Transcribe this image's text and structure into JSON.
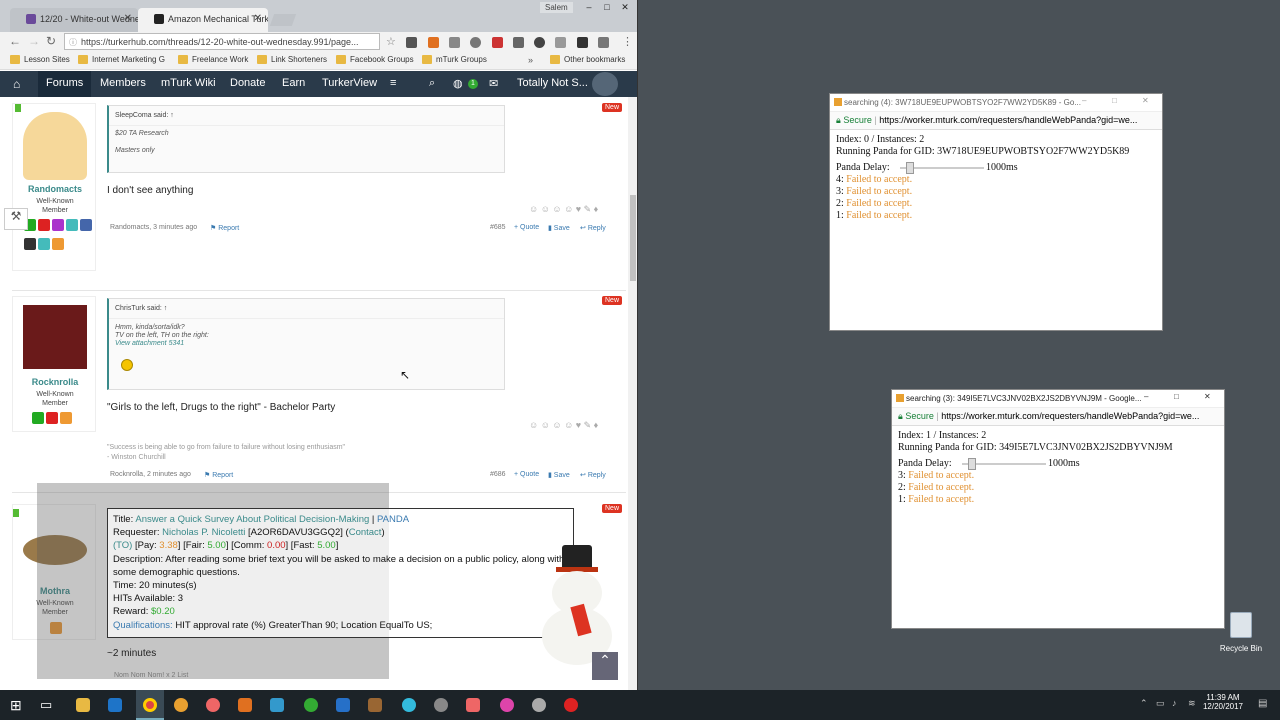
{
  "chrome": {
    "tabs": [
      {
        "label": "12/20 - White-out Wedne"
      },
      {
        "label": "Amazon Mechanical Turk"
      }
    ],
    "user_badge": "Salem",
    "url": "https://turkerhub.com/threads/12-20-white-out-wednesday.991/page...",
    "bookmarks": [
      "Lesson Sites",
      "Internet Marketing G",
      "Freelance Work",
      "Link Shorteners",
      "Facebook Groups",
      "mTurk Groups"
    ],
    "other_bookmarks": "Other bookmarks",
    "overflow": "»"
  },
  "sitenav": {
    "items": [
      "Forums",
      "Members",
      "mTurk Wiki",
      "Donate",
      "Earn",
      "TurkerView"
    ],
    "user": "Totally Not S...",
    "badge": "1"
  },
  "posts": [
    {
      "username": "Randomacts",
      "role": "Well-Known Member",
      "quote_by": "SleepComa said: ↑",
      "quote_lines": [
        "$20 TA Research",
        "Masters only"
      ],
      "message": "I don't see anything",
      "meta": "Randomacts, 3 minutes ago",
      "report": "Report",
      "number": "#685",
      "badge": "New"
    },
    {
      "username": "Rocknrolla",
      "role": "Well-Known Member",
      "quote_by": "ChrisTurk said: ↑",
      "quote_lines": [
        "Hmm, kinda/sorta/idk?",
        "TV on the left, TH on the right:"
      ],
      "attachment": "View attachment 5341",
      "message": "\"Girls to the left, Drugs to the right\" - Bachelor Party",
      "signature": "\"Success is being able to go from failure to failure without losing enthusiasm\"",
      "signature_by": "- Winston Churchill",
      "meta": "Rocknrolla, 2 minutes ago",
      "report": "Report",
      "number": "#686",
      "badge": "New"
    },
    {
      "username": "Mothra",
      "role": "Well-Known Member",
      "badge": "New",
      "footer": "~2 minutes",
      "reaction_line": "Nom Nom Nom! x 2 List"
    }
  ],
  "post_actions": {
    "quote": "+ Quote",
    "save": "Save",
    "reply": "Reply"
  },
  "hit": {
    "title_label": "Title:",
    "title": "Answer a Quick Survey About Political Decision-Making",
    "sep": " | ",
    "panda": "PANDA",
    "requester_label": "Requester:",
    "requester": "Nicholas P. Nicoletti",
    "requester_id": "[A2OR6DAVU3GGQ2]",
    "contact": "Contact",
    "to": "(TO)",
    "pay_label": "[Pay: ",
    "pay": "3.38",
    "fair_label": "] [Fair: ",
    "fair": "5.00",
    "comm_label": "] [Comm: ",
    "comm": "0.00",
    "fast_label": "] [Fast: ",
    "fast": "5.00",
    "close": "]",
    "desc_label": "Description:",
    "description": "After reading some brief text you will be asked to make a decision on a public policy, along with some demographic questions.",
    "time_label": "Time:",
    "time": "20 minutes(s)",
    "hits_label": "HITs Available:",
    "hits": "3",
    "reward_label": "Reward:",
    "reward": "$0.20",
    "qual_label": "Qualifications:",
    "quals": "HIT approval rate (%) GreaterThan 90; Location EqualTo US;"
  },
  "popup1": {
    "title": "searching (4): 3W718UE9EUPWOBTSYO2F7WW2YD5K89 - Go...",
    "secure": "Secure",
    "url": "https://worker.mturk.com/requesters/handleWebPanda?gid=we...",
    "index": "Index: 0 / Instances: 2",
    "running": "Running Panda for GID: 3W718UE9EUPWOBTSYO2F7WW2YD5K89",
    "delay_label": "Panda Delay:",
    "delay": "1000ms",
    "log": [
      {
        "n": "4:",
        "msg": "Failed to accept."
      },
      {
        "n": "3:",
        "msg": "Failed to accept."
      },
      {
        "n": "2:",
        "msg": "Failed to accept."
      },
      {
        "n": "1:",
        "msg": "Failed to accept."
      }
    ]
  },
  "popup2": {
    "title": "searching (3): 349I5E7LVC3JNV02BX2JS2DBYVNJ9M - Google...",
    "secure": "Secure",
    "url": "https://worker.mturk.com/requesters/handleWebPanda?gid=we...",
    "index": "Index: 1 / Instances: 2",
    "running": "Running Panda for GID: 349I5E7LVC3JNV02BX2JS2DBYVNJ9M",
    "delay_label": "Panda Delay:",
    "delay": "1000ms",
    "log": [
      {
        "n": "3:",
        "msg": "Failed to accept."
      },
      {
        "n": "2:",
        "msg": "Failed to accept."
      },
      {
        "n": "1:",
        "msg": "Failed to accept."
      }
    ]
  },
  "desktop": {
    "recycle_bin": "Recycle Bin"
  },
  "taskbar": {
    "time": "11:39 AM",
    "date": "12/20/2017"
  },
  "colors": {
    "accent": "#3a8a8a",
    "nav_bg": "#2a3a4a",
    "fail": "#e09030",
    "new_badge": "#dd3322"
  }
}
